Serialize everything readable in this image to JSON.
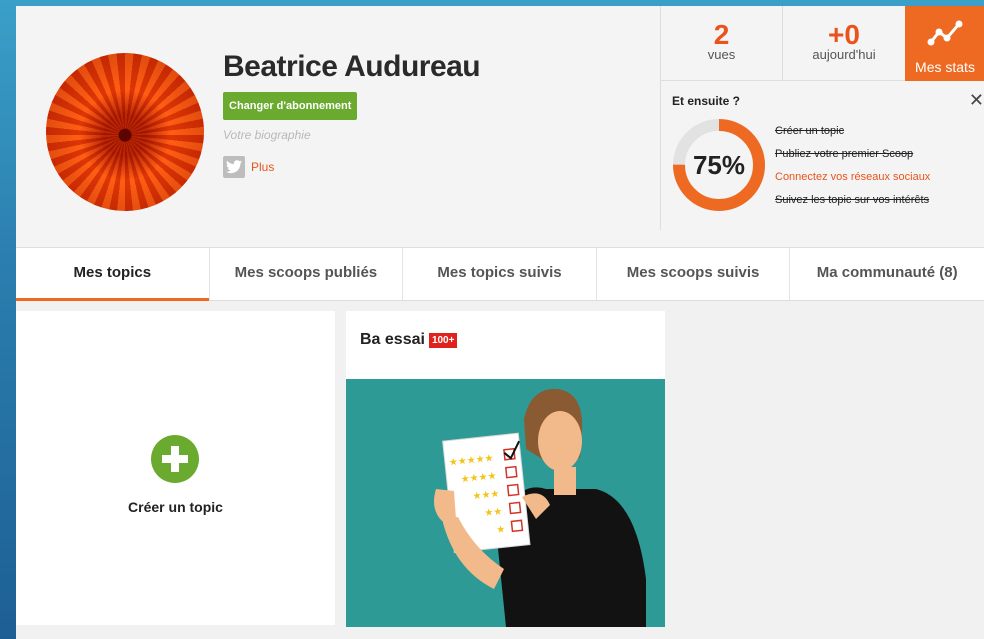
{
  "profile": {
    "name": "Beatrice Audureau",
    "subscription_label": "Changer d'abonnement",
    "bio_placeholder": "Votre biographie",
    "social_more": "Plus"
  },
  "stats": {
    "views_value": "2",
    "views_label": "vues",
    "today_value": "+0",
    "today_label": "aujourd'hui",
    "stats_label": "Mes stats"
  },
  "next_steps": {
    "title": "Et ensuite ?",
    "progress_percent": 75,
    "progress_label": "75%",
    "items": [
      {
        "label": "Créer un topic",
        "done": true
      },
      {
        "label": "Publiez votre premier Scoop",
        "done": true
      },
      {
        "label": "Connectez vos réseaux sociaux",
        "done": false
      },
      {
        "label": "Suivez les topic sur vos intérêts",
        "done": true
      }
    ]
  },
  "tabs": [
    {
      "label": "Mes topics",
      "active": true
    },
    {
      "label": "Mes scoops publiés",
      "active": false
    },
    {
      "label": "Mes topics suivis",
      "active": false
    },
    {
      "label": "Mes scoops suivis",
      "active": false
    },
    {
      "label": "Ma communauté (8)",
      "active": false
    }
  ],
  "cards": {
    "create_label": "Créer un topic",
    "topic_title": "Ba essai",
    "topic_badge": "100+"
  },
  "colors": {
    "accent": "#ee6a22",
    "green": "#6aaa2e",
    "badge_red": "#e0221c",
    "teal": "#2e9a96"
  }
}
